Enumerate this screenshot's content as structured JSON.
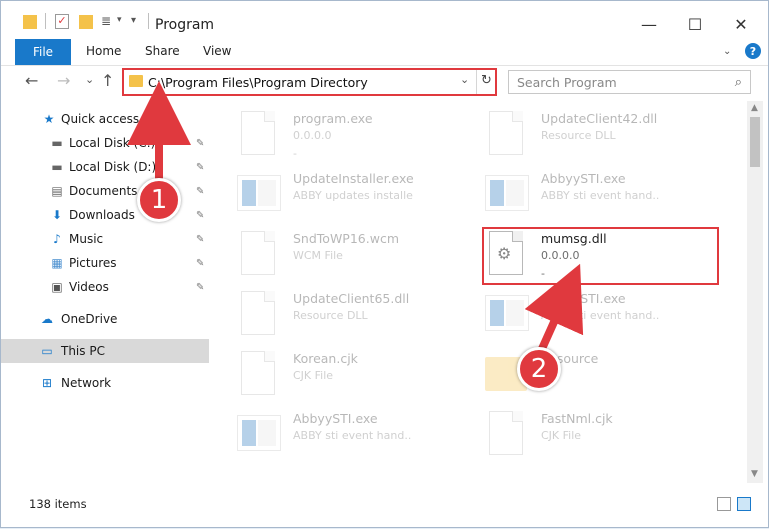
{
  "window": {
    "title": "Program",
    "controls": {
      "minimize": "—",
      "maximize": "☐",
      "close": "✕"
    }
  },
  "ribbon": {
    "file_label": "File",
    "tabs": [
      "Home",
      "Share",
      "View"
    ],
    "help": "?"
  },
  "address": {
    "path": "C:\\Program Files\\Program Directory",
    "dropdown": "⌄",
    "refresh": "↻"
  },
  "search": {
    "placeholder": "Search Program",
    "icon": "⌕"
  },
  "nav": {
    "back": "←",
    "forward": "→",
    "recent": "⌄",
    "up": "↑"
  },
  "sidebar": {
    "items": [
      {
        "label": "Quick access",
        "icon": "★"
      },
      {
        "label": "Local Disk (C:)",
        "icon": "▬"
      },
      {
        "label": "Local Disk (D:)",
        "icon": "▬"
      },
      {
        "label": "Documents",
        "icon": "▤"
      },
      {
        "label": "Downloads",
        "icon": "⬇"
      },
      {
        "label": "Music",
        "icon": "♪"
      },
      {
        "label": "Pictures",
        "icon": "▦"
      },
      {
        "label": "Videos",
        "icon": "▣"
      },
      {
        "label": "OneDrive",
        "icon": "☁"
      },
      {
        "label": "This PC",
        "icon": "▭"
      },
      {
        "label": "Network",
        "icon": "⊞"
      }
    ],
    "pin": "📌"
  },
  "files": [
    {
      "name": "program.exe",
      "sub": "0.0.0.0",
      "sub2": "-"
    },
    {
      "name": "UpdateClient42.dll",
      "sub": "Resource DLL",
      "sub2": ""
    },
    {
      "name": "UpdateInstaller.exe",
      "sub": "ABBY updates installe",
      "sub2": ""
    },
    {
      "name": "AbbyySTI.exe",
      "sub": "ABBY sti event hand..",
      "sub2": ""
    },
    {
      "name": "SndToWP16.wcm",
      "sub": "WCM File",
      "sub2": ""
    },
    {
      "name": "mumsg.dll",
      "sub": "0.0.0.0",
      "sub2": "-"
    },
    {
      "name": "UpdateClient65.dll",
      "sub": "Resource DLL",
      "sub2": ""
    },
    {
      "name": "AbbyySTI.exe",
      "sub": "ABBY sti event hand..",
      "sub2": ""
    },
    {
      "name": "Korean.cjk",
      "sub": "CJK File",
      "sub2": ""
    },
    {
      "name": "Resource",
      "sub": "",
      "sub2": ""
    },
    {
      "name": "AbbyySTI.exe",
      "sub": "ABBY sti event hand..",
      "sub2": ""
    },
    {
      "name": "FastNml.cjk",
      "sub": "CJK File",
      "sub2": ""
    }
  ],
  "annotations": {
    "marker1": "1",
    "marker2": "2"
  },
  "status": {
    "item_count": "138 items"
  },
  "colors": {
    "accent": "#1979ca",
    "highlight": "#e0393e",
    "folder": "#f4c24a"
  }
}
